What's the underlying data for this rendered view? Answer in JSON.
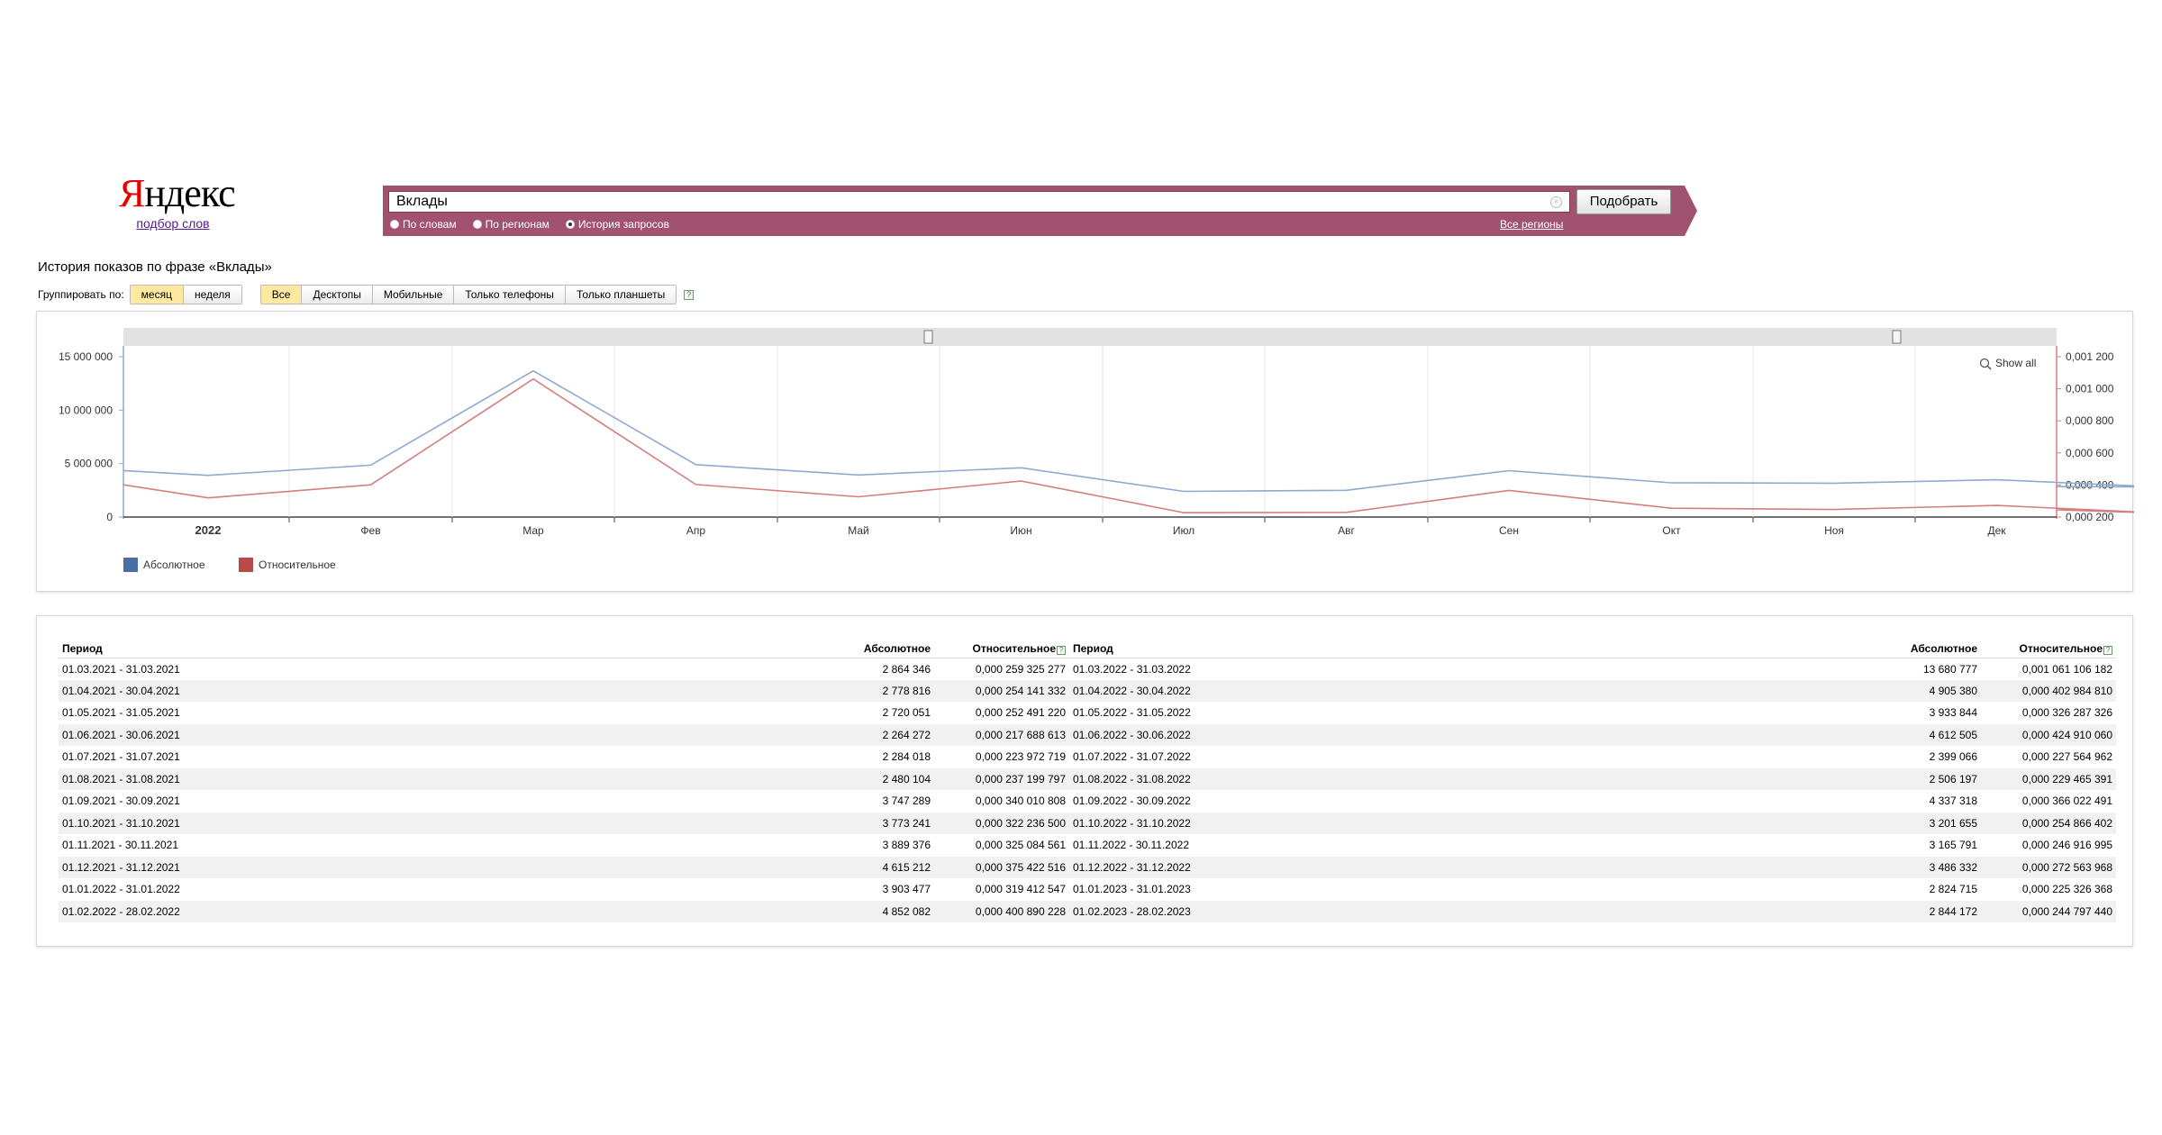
{
  "logo": {
    "first_letter": "Я",
    "rest": "ндекс",
    "subtitle": "подбор слов"
  },
  "search": {
    "value": "Вклады",
    "button_label": "Подобрать",
    "radios": [
      {
        "label": "По словам",
        "selected": false
      },
      {
        "label": "По регионам",
        "selected": false
      },
      {
        "label": "История запросов",
        "selected": true
      }
    ],
    "all_regions_link": "Все регионы"
  },
  "page_title": "История показов по фразе «Вклады»",
  "filters": {
    "group_label": "Группировать по:",
    "group_buttons": [
      {
        "label": "месяц",
        "active": true
      },
      {
        "label": "неделя",
        "active": false
      }
    ],
    "device_buttons": [
      {
        "label": "Все",
        "active": true
      },
      {
        "label": "Десктопы",
        "active": false
      },
      {
        "label": "Мобильные",
        "active": false
      },
      {
        "label": "Только телефоны",
        "active": false
      },
      {
        "label": "Только планшеты",
        "active": false
      }
    ],
    "help": "?"
  },
  "chart_data": {
    "type": "line",
    "show_all_label": "Show all",
    "x_labels": [
      "2022",
      "Фев",
      "Мар",
      "Апр",
      "Май",
      "Июн",
      "Июл",
      "Авг",
      "Сен",
      "Окт",
      "Ноя",
      "Дек"
    ],
    "left_axis": {
      "ticks": [
        "15 000 000",
        "10 000 000",
        "5 000 000",
        "0"
      ],
      "range": [
        0,
        15000000
      ]
    },
    "right_axis": {
      "ticks": [
        "0,001 200",
        "0,001 000",
        "0,000 800",
        "0,000 600",
        "0,000 400",
        "0,000 200"
      ],
      "range": [
        0.0002,
        0.0012
      ]
    },
    "series": [
      {
        "name": "Абсолютное",
        "color": "#8fa9cf",
        "legend_color": "#4a6fa5",
        "axis": "left",
        "values": [
          4352082,
          3903477,
          4852082,
          13680777,
          4905380,
          3933844,
          4612505,
          2399066,
          2506197,
          4337318,
          3201655,
          3165791,
          3486332,
          2824715,
          2844172
        ]
      },
      {
        "name": "Относительное",
        "color": "#d37f7f",
        "legend_color": "#b84a4a",
        "axis": "right",
        "values": [
          0.00040089,
          0.00031941,
          0.00040089,
          0.00106111,
          0.00040298,
          0.00032629,
          0.00042491,
          0.00022756,
          0.00022947,
          0.00036602,
          0.00025487,
          0.00024692,
          0.00027256,
          0.00022533,
          0.0002448
        ]
      }
    ]
  },
  "table": {
    "headers": {
      "period": "Период",
      "abs": "Абсолютное",
      "rel": "Относительное",
      "help": "?"
    },
    "left": [
      {
        "period": "01.03.2021 - 31.03.2021",
        "abs": "2 864 346",
        "rel": "0,000 259 325 277"
      },
      {
        "period": "01.04.2021 - 30.04.2021",
        "abs": "2 778 816",
        "rel": "0,000 254 141 332"
      },
      {
        "period": "01.05.2021 - 31.05.2021",
        "abs": "2 720 051",
        "rel": "0,000 252 491 220"
      },
      {
        "period": "01.06.2021 - 30.06.2021",
        "abs": "2 264 272",
        "rel": "0,000 217 688 613"
      },
      {
        "period": "01.07.2021 - 31.07.2021",
        "abs": "2 284 018",
        "rel": "0,000 223 972 719"
      },
      {
        "period": "01.08.2021 - 31.08.2021",
        "abs": "2 480 104",
        "rel": "0,000 237 199 797"
      },
      {
        "period": "01.09.2021 - 30.09.2021",
        "abs": "3 747 289",
        "rel": "0,000 340 010 808"
      },
      {
        "period": "01.10.2021 - 31.10.2021",
        "abs": "3 773 241",
        "rel": "0,000 322 236 500"
      },
      {
        "period": "01.11.2021 - 30.11.2021",
        "abs": "3 889 376",
        "rel": "0,000 325 084 561"
      },
      {
        "period": "01.12.2021 - 31.12.2021",
        "abs": "4 615 212",
        "rel": "0,000 375 422 516"
      },
      {
        "period": "01.01.2022 - 31.01.2022",
        "abs": "3 903 477",
        "rel": "0,000 319 412 547"
      },
      {
        "period": "01.02.2022 - 28.02.2022",
        "abs": "4 852 082",
        "rel": "0,000 400 890 228"
      }
    ],
    "right": [
      {
        "period": "01.03.2022 - 31.03.2022",
        "abs": "13 680 777",
        "rel": "0,001 061 106 182"
      },
      {
        "period": "01.04.2022 - 30.04.2022",
        "abs": "4 905 380",
        "rel": "0,000 402 984 810"
      },
      {
        "period": "01.05.2022 - 31.05.2022",
        "abs": "3 933 844",
        "rel": "0,000 326 287 326"
      },
      {
        "period": "01.06.2022 - 30.06.2022",
        "abs": "4 612 505",
        "rel": "0,000 424 910 060"
      },
      {
        "period": "01.07.2022 - 31.07.2022",
        "abs": "2 399 066",
        "rel": "0,000 227 564 962"
      },
      {
        "period": "01.08.2022 - 31.08.2022",
        "abs": "2 506 197",
        "rel": "0,000 229 465 391"
      },
      {
        "period": "01.09.2022 - 30.09.2022",
        "abs": "4 337 318",
        "rel": "0,000 366 022 491"
      },
      {
        "period": "01.10.2022 - 31.10.2022",
        "abs": "3 201 655",
        "rel": "0,000 254 866 402"
      },
      {
        "period": "01.11.2022 - 30.11.2022",
        "abs": "3 165 791",
        "rel": "0,000 246 916 995"
      },
      {
        "period": "01.12.2022 - 31.12.2022",
        "abs": "3 486 332",
        "rel": "0,000 272 563 968"
      },
      {
        "period": "01.01.2023 - 31.01.2023",
        "abs": "2 824 715",
        "rel": "0,000 225 326 368"
      },
      {
        "period": "01.02.2023 - 28.02.2023",
        "abs": "2 844 172",
        "rel": "0,000 244 797 440"
      }
    ]
  }
}
